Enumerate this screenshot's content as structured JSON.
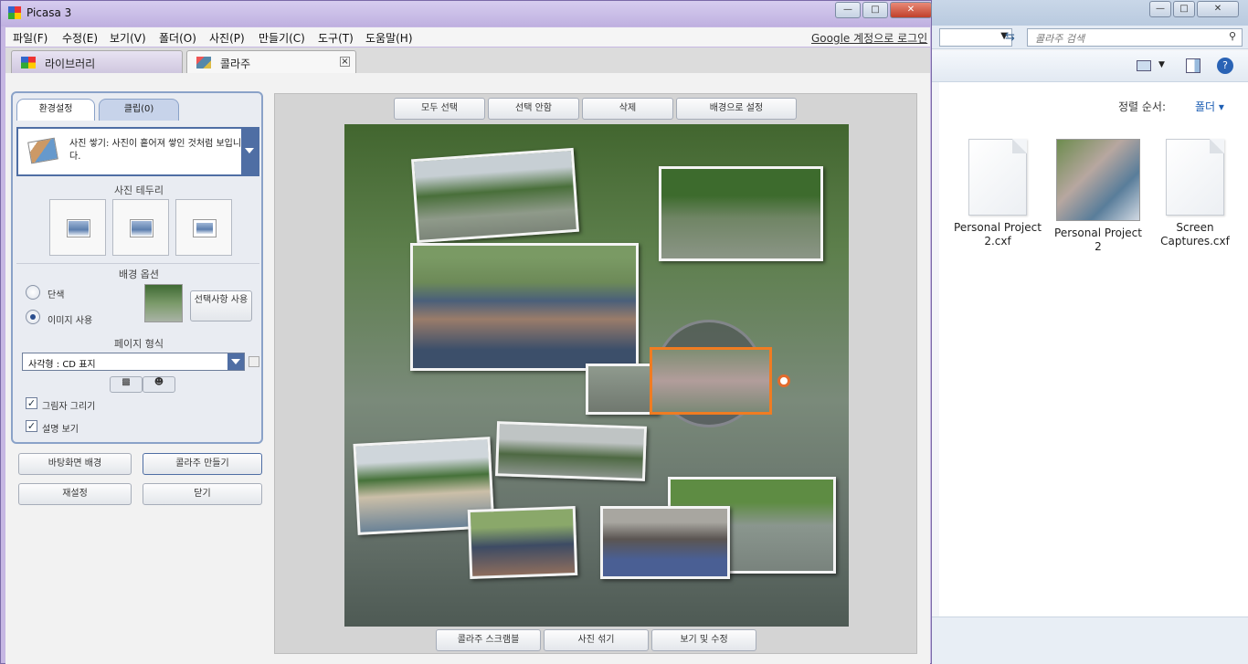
{
  "explorer": {
    "search_placeholder": "콜라주 검색",
    "sort_label": "정렬 순서:",
    "sort_value": "폴더",
    "files": [
      {
        "name": "Personal Project 2.cxf",
        "type": "document"
      },
      {
        "name": "Personal Project 2",
        "type": "image-thumbnail"
      },
      {
        "name": "Screen Captures.cxf",
        "type": "document"
      }
    ]
  },
  "app": {
    "title": "Picasa 3",
    "menus": [
      "파일(F)",
      "수정(E)",
      "보기(V)",
      "폴더(O)",
      "사진(P)",
      "만들기(C)",
      "도구(T)",
      "도움말(H)"
    ],
    "login_link": "Google 계정으로 로그인",
    "tabs": [
      {
        "label": "라이브러리",
        "active": false
      },
      {
        "label": "콜라주",
        "active": true
      }
    ]
  },
  "panel": {
    "tab_settings": "환경설정",
    "tab_clips": "클립(0)",
    "style_desc": "사진 쌓기: 사진이 흩어져 쌓인 것처럼 보입니다.",
    "border_title": "사진 테두리",
    "bg_title": "배경 옵션",
    "bg_solid": "단색",
    "bg_image": "이미지 사용",
    "bg_use_selected": "선택사항 사용",
    "page_format_title": "페이지 형식",
    "page_format_value": "사각형 : CD 표지",
    "draw_shadows": "그림자 그리기",
    "show_captions": "설명 보기",
    "btn_desktop": "바탕화면 배경",
    "btn_create": "콜라주 만들기",
    "btn_reset": "재설정",
    "btn_close": "닫기"
  },
  "canvas_toolbar": {
    "select_all": "모두 선택",
    "deselect": "선택 안함",
    "delete": "삭제",
    "set_background": "배경으로 설정"
  },
  "canvas_bottom": {
    "scramble": "콜라주 스크램블",
    "shuffle": "사진 섞기",
    "view_edit": "보기 및 수정"
  },
  "colors": {
    "accent": "#4f6ea4",
    "selection": "#f07c22",
    "window_frame": "#c6b7e3"
  }
}
